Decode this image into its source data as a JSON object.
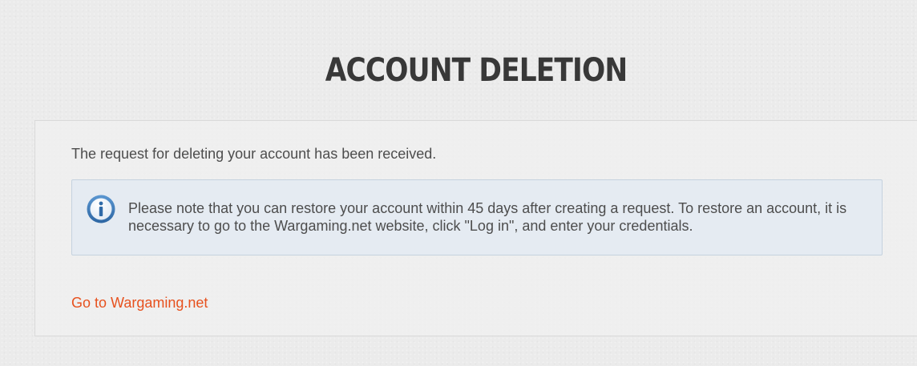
{
  "page": {
    "title": "ACCOUNT DELETION"
  },
  "panel": {
    "request_message": "The request for deleting your account has been received.",
    "notice": {
      "icon": "info-icon",
      "text": "Please note that you can restore your account within 45 days after creating a request. To restore an account, it is necessary to go to the Wargaming.net website, click \"Log in\", and enter your credentials."
    },
    "link_label": "Go to Wargaming.net"
  },
  "colors": {
    "background": "#ebebeb",
    "title": "#383838",
    "text": "#4d4d4d",
    "notice_background": "#e5ebf2",
    "notice_border": "#c5d2df",
    "info_icon": "#3a7bbd",
    "link": "#e7511e"
  }
}
